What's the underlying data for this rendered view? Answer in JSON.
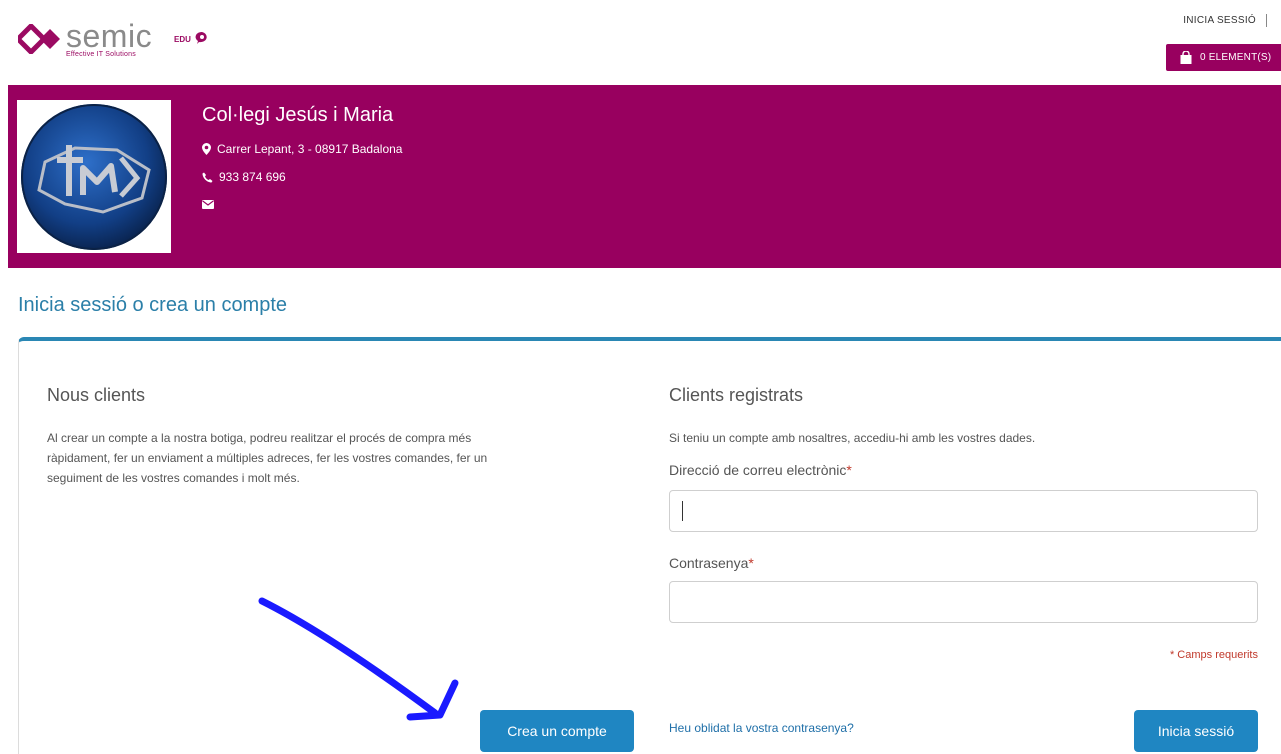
{
  "header": {
    "logo_word": "semic",
    "logo_tagline": "Effective IT Solutions",
    "logo_edu": "EDU",
    "login_link": "INICIA SESSIÓ",
    "cart_label": "0 ELEMENT(S)"
  },
  "school": {
    "name": "Col·legi Jesús i Maria",
    "address": "Carrer Lepant, 3 - 08917 Badalona",
    "phone": "933 874 696",
    "email_icon": "envelope-icon"
  },
  "page": {
    "title": "Inicia sessió o crea un compte"
  },
  "new_customers": {
    "title": "Nous clients",
    "description_lines": [
      "Al crear un compte a la nostra botiga, podreu realitzar el procés de compra més",
      "ràpidament, fer un enviament a múltiples adreces, fer les vostres comandes, fer un",
      "seguiment de les vostres comandes i molt més."
    ],
    "create_button": "Crea un compte"
  },
  "registered": {
    "title": "Clients registrats",
    "description": "Si teniu un compte amb nosaltres, accediu-hi amb les vostres dades.",
    "email_label": "Direcció de correu electrònic",
    "email_value": "",
    "password_label": "Contrasenya",
    "password_value": "",
    "required_marker": "*",
    "required_note": "* Camps requerits",
    "forgot_link": "Heu oblidat la vostra contrasenya?",
    "login_button": "Inicia sessió"
  },
  "colors": {
    "brand": "#98005f",
    "accent": "#1f86c2",
    "heading": "#2b7fa8",
    "annotation": "#1a1aff"
  }
}
